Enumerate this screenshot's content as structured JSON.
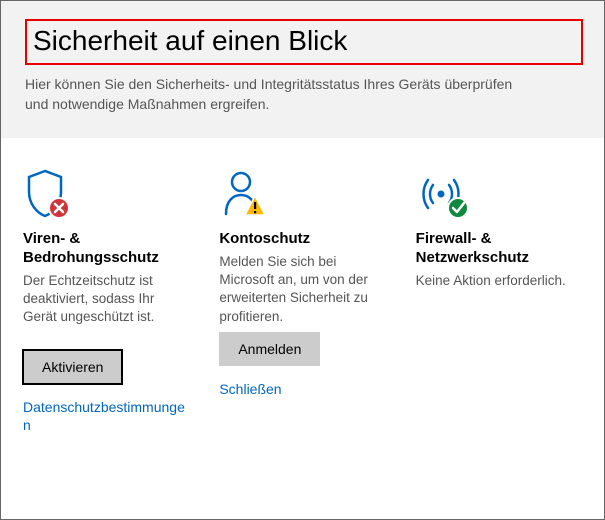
{
  "header": {
    "title": "Sicherheit auf einen Blick",
    "subtitle": "Hier können Sie den Sicherheits- und Integritätsstatus Ihres Geräts überprüfen und notwendige Maßnahmen ergreifen."
  },
  "tiles": {
    "virus": {
      "title": "Viren- & Bedrohungsschutz",
      "desc": "Der Echtzeitschutz ist deaktiviert, sodass Ihr Gerät ungeschützt ist.",
      "button": "Aktivieren",
      "link": "Datenschutzbestimmungen"
    },
    "account": {
      "title": "Kontoschutz",
      "desc": "Melden Sie sich bei Microsoft an, um von der erweiterten Sicherheit zu profitieren.",
      "button": "Anmelden",
      "link": "Schließen"
    },
    "firewall": {
      "title": "Firewall- & Netzwerkschutz",
      "desc": "Keine Aktion erforderlich."
    }
  },
  "icons": {
    "virus": "shield-error-icon",
    "account": "account-warning-icon",
    "firewall": "broadcast-ok-icon"
  },
  "colors": {
    "brand_blue": "#0067c0",
    "error_red": "#e60000",
    "error_badge": "#d13438",
    "warn_yellow": "#ffb900",
    "ok_green": "#10893e"
  }
}
